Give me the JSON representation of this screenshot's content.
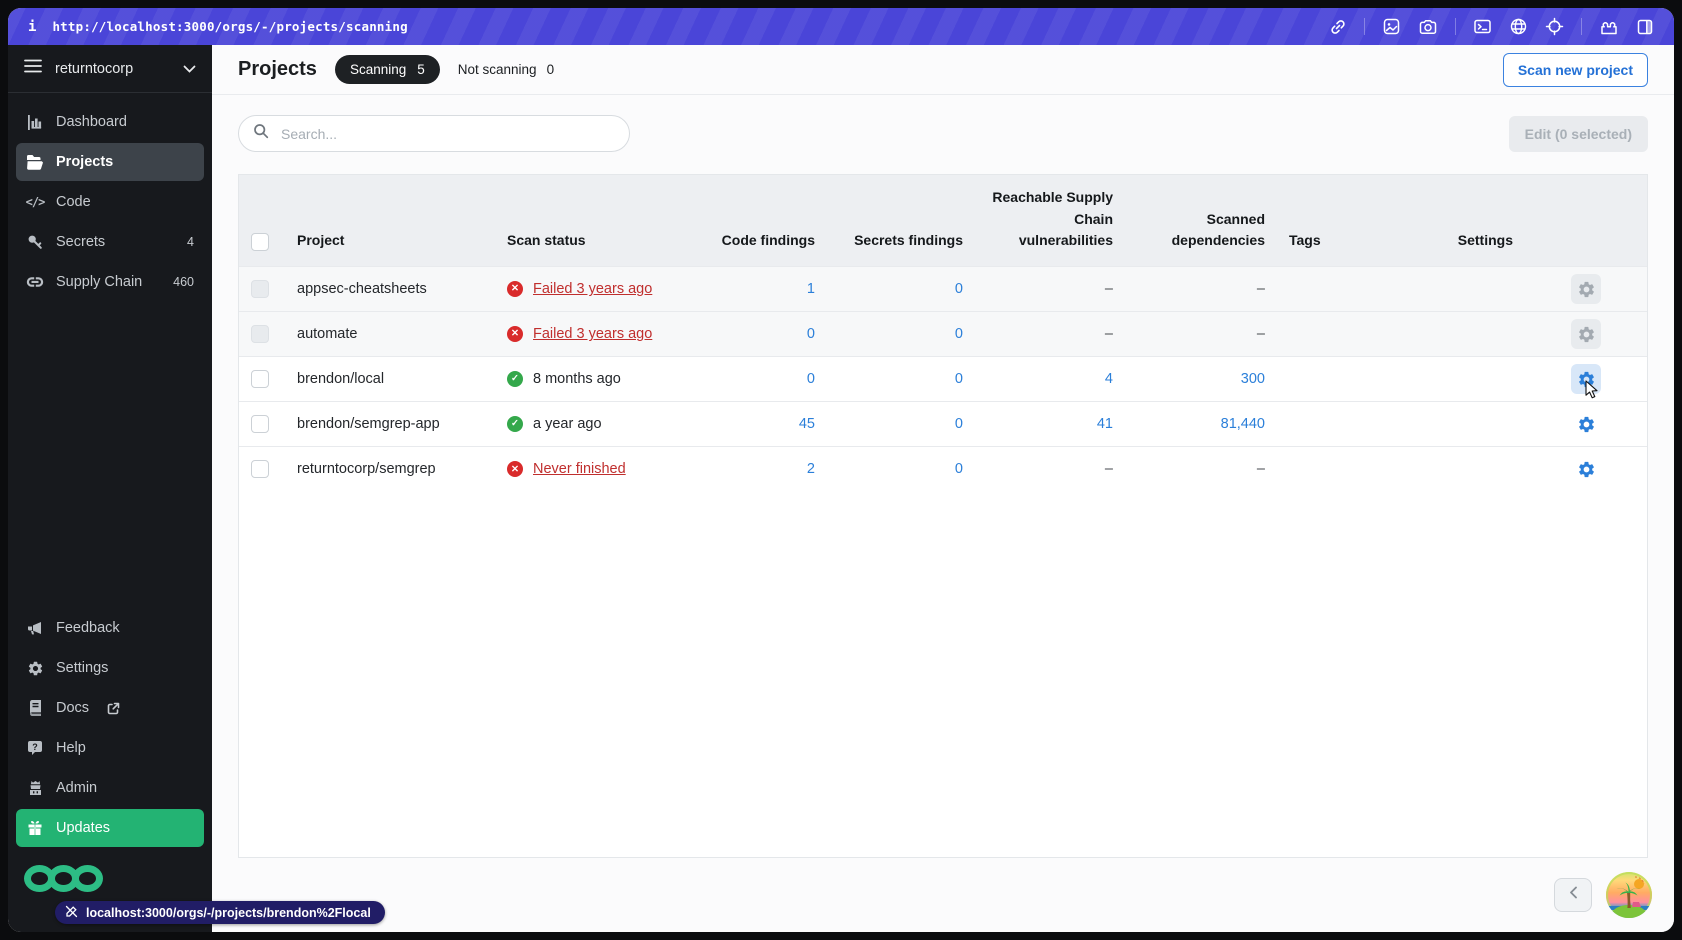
{
  "browser": {
    "info_glyph": "i",
    "url": "http://localhost:3000/orgs/-/projects/scanning",
    "toolbar_icons": [
      "link-icon",
      "image-icon",
      "camera-icon",
      "terminal-icon",
      "globe-icon",
      "crosshair-icon",
      "puzzle-icon",
      "split-panel-icon"
    ],
    "status_bubble": {
      "icon": "pen-slash-icon",
      "text": "localhost:3000/orgs/-/projects/brendon%2Flocal"
    }
  },
  "sidebar": {
    "org_name": "returntocorp",
    "items": [
      {
        "icon": "dashboard-chart-icon",
        "label": "Dashboard"
      },
      {
        "icon": "folder-icon",
        "label": "Projects",
        "active": true
      },
      {
        "icon": "code-icon",
        "label": "Code"
      },
      {
        "icon": "key-icon",
        "label": "Secrets",
        "badge": "4"
      },
      {
        "icon": "chain-link-icon",
        "label": "Supply Chain",
        "badge": "460"
      }
    ],
    "footer_items": [
      {
        "icon": "megaphone-icon",
        "label": "Feedback"
      },
      {
        "icon": "gear-icon",
        "label": "Settings"
      },
      {
        "icon": "book-icon",
        "label": "Docs",
        "external_link": true
      },
      {
        "icon": "help-bubble-icon",
        "label": "Help"
      },
      {
        "icon": "admin-icon",
        "label": "Admin"
      },
      {
        "icon": "gift-icon",
        "label": "Updates",
        "highlighted": true
      }
    ]
  },
  "header": {
    "title": "Projects",
    "scanning_label": "Scanning",
    "scanning_count": "5",
    "not_scanning_label": "Not scanning",
    "not_scanning_count": "0",
    "scan_new_button": "Scan new project"
  },
  "toolbar": {
    "search_placeholder": "Search...",
    "edit_button": "Edit (0 selected)"
  },
  "table": {
    "columns": [
      "Project",
      "Scan status",
      "Code findings",
      "Secrets findings",
      "Reachable Supply Chain vulnerabilities",
      "Scanned dependencies",
      "Tags",
      "Settings"
    ],
    "rows": [
      {
        "project": "appsec-cheatsheets",
        "scan_status": "Failed 3 years ago",
        "status_type": "failed",
        "code_findings": "1",
        "secrets_findings": "0",
        "reachable_vulns": "–",
        "scanned_deps": "–",
        "tags": "",
        "muted": true
      },
      {
        "project": "automate",
        "scan_status": "Failed 3 years ago",
        "status_type": "failed",
        "code_findings": "0",
        "secrets_findings": "0",
        "reachable_vulns": "–",
        "scanned_deps": "–",
        "tags": "",
        "muted": true
      },
      {
        "project": "brendon/local",
        "scan_status": "8 months ago",
        "status_type": "success",
        "code_findings": "0",
        "secrets_findings": "0",
        "reachable_vulns": "4",
        "scanned_deps": "300",
        "tags": "",
        "muted": false
      },
      {
        "project": "brendon/semgrep-app",
        "scan_status": "a year ago",
        "status_type": "success",
        "code_findings": "45",
        "secrets_findings": "0",
        "reachable_vulns": "41",
        "scanned_deps": "81,440",
        "tags": "",
        "muted": false
      },
      {
        "project": "returntocorp/semgrep",
        "scan_status": "Never finished",
        "status_type": "failed",
        "code_findings": "2",
        "secrets_findings": "0",
        "reachable_vulns": "–",
        "scanned_deps": "–",
        "tags": "",
        "muted": false
      }
    ]
  },
  "colors": {
    "topbar_purple": "#4a45d8",
    "sidebar_bg": "#17191d",
    "active_item_bg": "#3d434a",
    "updates_green": "#23b373",
    "logo_green": "#2dbd85",
    "accent_blue": "#2b7fd9",
    "failed_red": "#c02f2e",
    "failed_icon_red": "#d92b2b",
    "success_green": "#34a84b",
    "scanning_pill_bg": "#1e2124",
    "status_bubble_bg": "#211d66"
  }
}
